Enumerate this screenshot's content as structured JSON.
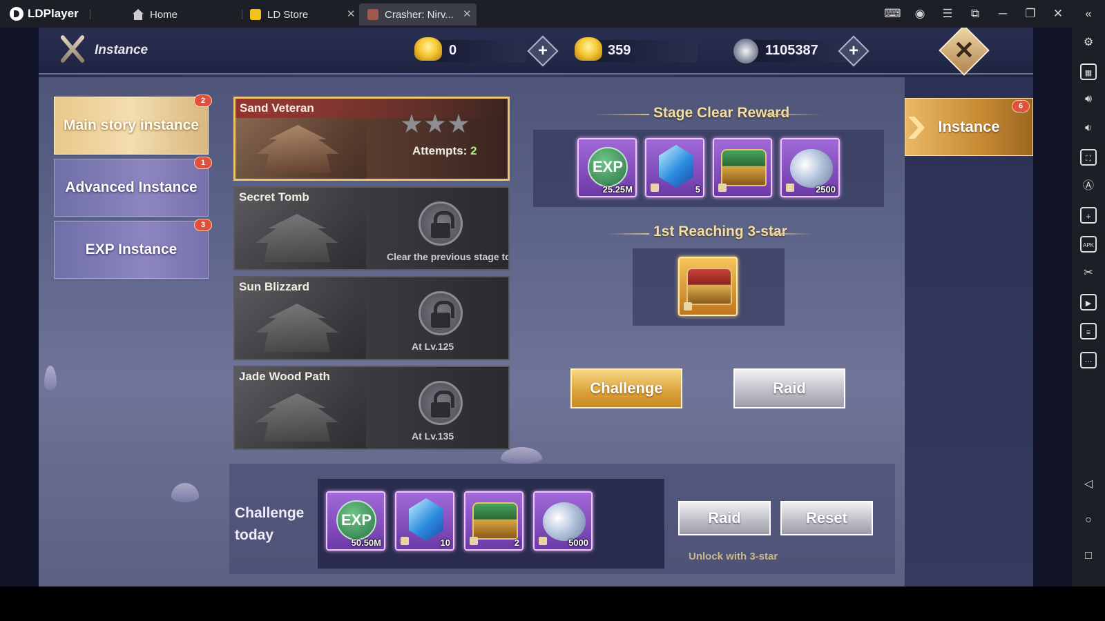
{
  "emulator": {
    "brand": "LDPlayer",
    "tabs": [
      {
        "label": "Home",
        "closable": false
      },
      {
        "label": "LD Store",
        "closable": true
      },
      {
        "label": "Crasher: Nirv...",
        "closable": true
      }
    ]
  },
  "hud": {
    "title": "Instance",
    "currencies": [
      {
        "icon": "gold-ingot-icon",
        "value": "0",
        "has_plus": true
      },
      {
        "icon": "bound-gold-ingot-icon",
        "value": "359",
        "has_plus": false
      },
      {
        "icon": "silver-coin-icon",
        "value": "1105387",
        "has_plus": true
      }
    ]
  },
  "categories": [
    {
      "label": "Main story instance",
      "badge": "2",
      "active": true
    },
    {
      "label": "Advanced Instance",
      "badge": "1",
      "active": false
    },
    {
      "label": "EXP Instance",
      "badge": "3",
      "active": false
    }
  ],
  "stages": [
    {
      "name": "Sand Veteran",
      "active": true,
      "stars": 3,
      "attempts_label": "Attempts:",
      "attempts_value": "2"
    },
    {
      "name": "Secret Tomb",
      "active": false,
      "locked": true,
      "note": "Clear the previous stage to"
    },
    {
      "name": "Sun Blizzard",
      "active": false,
      "locked": true,
      "note": "At Lv.125"
    },
    {
      "name": "Jade Wood Path",
      "active": false,
      "locked": true,
      "note": "At Lv.135"
    }
  ],
  "stage_clear_reward": {
    "title": "Stage Clear Reward",
    "items": [
      {
        "icon": "exp-orb-icon",
        "qty": "25.25M"
      },
      {
        "icon": "blue-gem-icon",
        "qty": "5"
      },
      {
        "icon": "green-chest-icon",
        "qty": ""
      },
      {
        "icon": "silver-coins-icon",
        "qty": "2500"
      }
    ]
  },
  "first_three_star": {
    "title": "1st Reaching 3-star",
    "items": [
      {
        "icon": "red-chest-icon",
        "qty": ""
      }
    ]
  },
  "actions": {
    "challenge": "Challenge",
    "raid": "Raid"
  },
  "side_tab": {
    "label": "Instance",
    "badge": "6"
  },
  "today": {
    "label_line1": "Challenge",
    "label_line2": "today",
    "items": [
      {
        "icon": "exp-orb-icon",
        "qty": "50.50M"
      },
      {
        "icon": "blue-gem-icon",
        "qty": "10"
      },
      {
        "icon": "green-chest-icon",
        "qty": "2"
      },
      {
        "icon": "silver-coins-icon",
        "qty": "5000"
      }
    ],
    "raid": "Raid",
    "reset": "Reset",
    "unlock_note": "Unlock with 3-star"
  },
  "colors": {
    "accent_gold": "#f0c46c",
    "panel": "#5d6489",
    "chrome": "#1d1f27",
    "badge_red": "#e0503c"
  }
}
